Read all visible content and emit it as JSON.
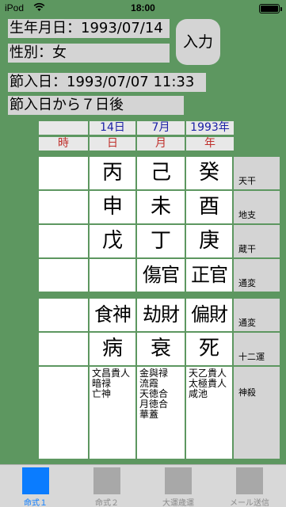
{
  "status": {
    "carrier": "iPod",
    "time": "18:00"
  },
  "info": {
    "birthday": "生年月日：1993/07/14",
    "gender": "性別：女",
    "setsuiri": "節入日：1993/07/07 11:33",
    "after": "節入日から７日後"
  },
  "input_button": "入力",
  "dates": [
    "14日",
    "7月",
    "1993年"
  ],
  "pillars": [
    "時",
    "日",
    "月",
    "年"
  ],
  "rows": {
    "tenkan": {
      "label": "天干",
      "cells": [
        "",
        "丙",
        "己",
        "癸"
      ]
    },
    "chishi": {
      "label": "地支",
      "cells": [
        "",
        "申",
        "未",
        "酉"
      ]
    },
    "zoukan": {
      "label": "蔵干",
      "cells": [
        "",
        "戊",
        "丁",
        "庚"
      ]
    },
    "tsuhen1": {
      "label": "通変",
      "cells": [
        "",
        "",
        "傷官",
        "正官"
      ]
    },
    "tsuhen2": {
      "label": "通変",
      "cells": [
        "",
        "食神",
        "劫財",
        "偏財"
      ]
    },
    "juniun": {
      "label": "十二運",
      "cells": [
        "",
        "病",
        "衰",
        "死"
      ]
    },
    "shinsatsu": {
      "label": "神殺",
      "cells": [
        [],
        [
          "文昌貴人",
          "暗禄",
          "亡神"
        ],
        [
          "金與禄",
          "流霞",
          "天徳合",
          "月徳合",
          "華蓋"
        ],
        [
          "天乙貴人",
          "太極貴人",
          "咸池"
        ]
      ]
    }
  },
  "tabs": [
    {
      "label": "命式１",
      "active": true
    },
    {
      "label": "命式２",
      "active": false
    },
    {
      "label": "大運歳運",
      "active": false
    },
    {
      "label": "メール送信",
      "active": false
    }
  ],
  "colors": {
    "background": "#5d9760",
    "date": "#1b21a6",
    "pillar": "#c0302c",
    "active_tab": "#0a7cff"
  }
}
